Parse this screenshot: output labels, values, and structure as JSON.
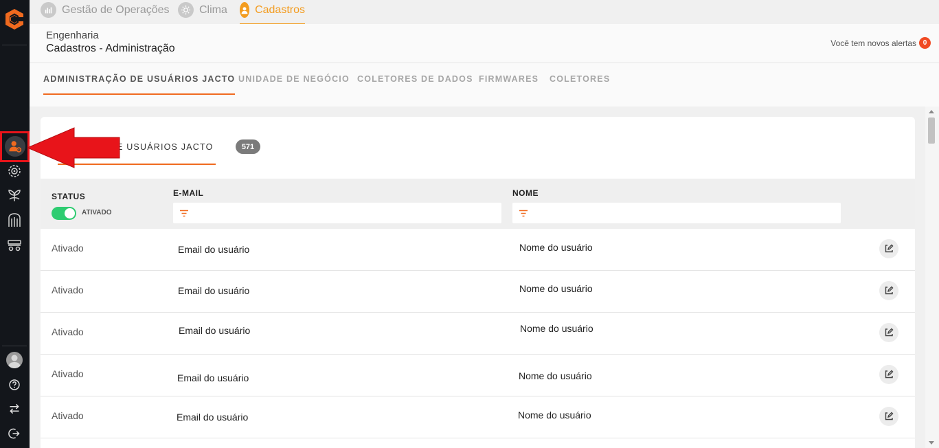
{
  "top_tabs": [
    {
      "label": "Gestão de Operações",
      "icon": "chart-icon",
      "active": false
    },
    {
      "label": "Clima",
      "icon": "sun-icon",
      "active": false
    },
    {
      "label": "Cadastros",
      "icon": "user-icon",
      "active": true
    }
  ],
  "header": {
    "subtitle": "Engenharia",
    "title": "Cadastros - Administração",
    "alerts_text": "Você tem novos alertas",
    "alerts_count": "0"
  },
  "section_tabs": [
    {
      "label": "ADMINISTRAÇÃO DE USUÁRIOS JACTO",
      "active": true
    },
    {
      "label": "UNIDADE DE NEGÓCIO",
      "active": false
    },
    {
      "label": "COLETORES DE DADOS",
      "active": false
    },
    {
      "label": "FIRMWARES",
      "active": false
    },
    {
      "label": "COLETORES",
      "active": false
    }
  ],
  "card": {
    "tab_label": "E USUÁRIOS JACTO",
    "count": "571"
  },
  "table": {
    "headers": {
      "status": "STATUS",
      "email": "E-MAIL",
      "name": "NOME"
    },
    "status_filter_label": "ATIVADO",
    "rows": [
      {
        "status": "Ativado",
        "email": "Email do usuário",
        "name": "Nome do usuário"
      },
      {
        "status": "Ativado",
        "email": "Email do usuário",
        "name": "Nome do usuário"
      },
      {
        "status": "Ativado",
        "email": "Email do usuário",
        "name": "Nome do usuário"
      },
      {
        "status": "Ativado",
        "email": "Email do usuário",
        "name": "Nome do usuário"
      },
      {
        "status": "Ativado",
        "email": "Email do usuário",
        "name": "Nome do usuário"
      }
    ]
  },
  "sidebar": {
    "items": [
      "user-settings-icon",
      "gear-target-icon",
      "plant-icon",
      "silo-icon",
      "sprayer-icon"
    ],
    "bottom": [
      "avatar",
      "help-icon",
      "swap-icon",
      "logout-icon"
    ]
  },
  "colors": {
    "accent": "#f06a1f",
    "toggle": "#2ecc71",
    "annotation": "#e8141a"
  }
}
